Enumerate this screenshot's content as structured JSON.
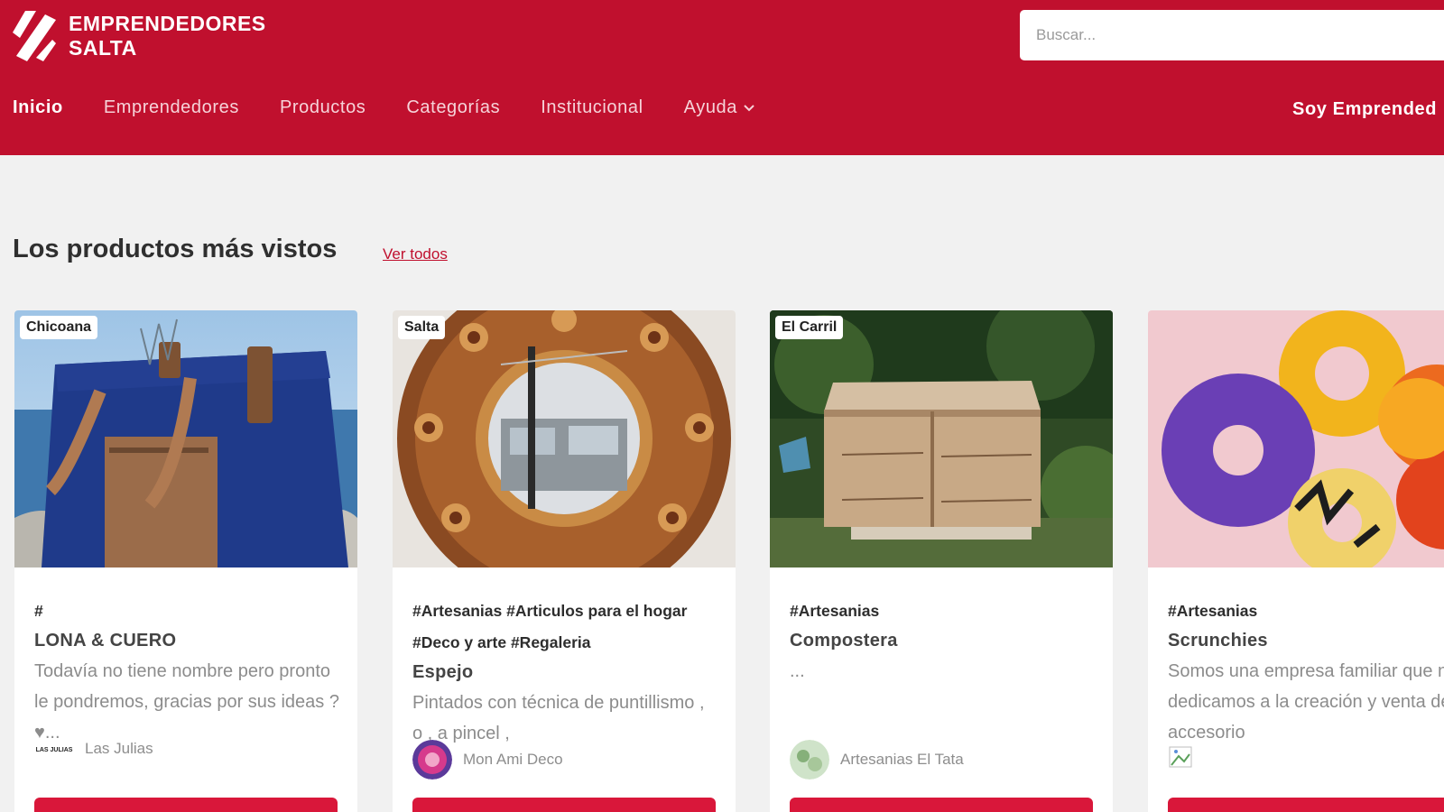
{
  "brand": {
    "logo_line1": "EMPRENDEDORES",
    "logo_line2": "SALTA",
    "primary_color": "#c0102e"
  },
  "search": {
    "placeholder": "Buscar..."
  },
  "nav": {
    "items": [
      {
        "label": "Inicio",
        "active": true
      },
      {
        "label": "Emprendedores"
      },
      {
        "label": "Productos"
      },
      {
        "label": "Categorías"
      },
      {
        "label": "Institucional"
      },
      {
        "label": "Ayuda",
        "icon": "chevron-down-icon"
      }
    ],
    "right_label": "Soy Emprended"
  },
  "section": {
    "title": "Los productos más vistos",
    "see_all": "Ver todos"
  },
  "products": [
    {
      "location": "Chicoana",
      "tags": "#",
      "title": "LONA & CUERO",
      "description": "Todavía no tiene nombre pero pronto le pondremos, gracias por sus ideas ? ♥...",
      "seller": "Las Julias",
      "seller_logo_text": "LAS JULIAS"
    },
    {
      "location": "Salta",
      "tags": "#Artesanias #Articulos para el hogar #Deco y arte #Regaleria",
      "title": "Espejo",
      "description": "Pintados con técnica de puntillismo , o , a pincel ,",
      "seller": "Mon Ami Deco"
    },
    {
      "location": "El Carril",
      "tags": "#Artesanias",
      "title": "Compostera",
      "description": "...",
      "seller": "Artesanias El Tata"
    },
    {
      "location": "",
      "tags": "#Artesanias",
      "title": "Scrunchies",
      "description": "Somos una empresa familiar que nos dedicamos a la creación y venta de accesorio",
      "seller": ""
    }
  ]
}
